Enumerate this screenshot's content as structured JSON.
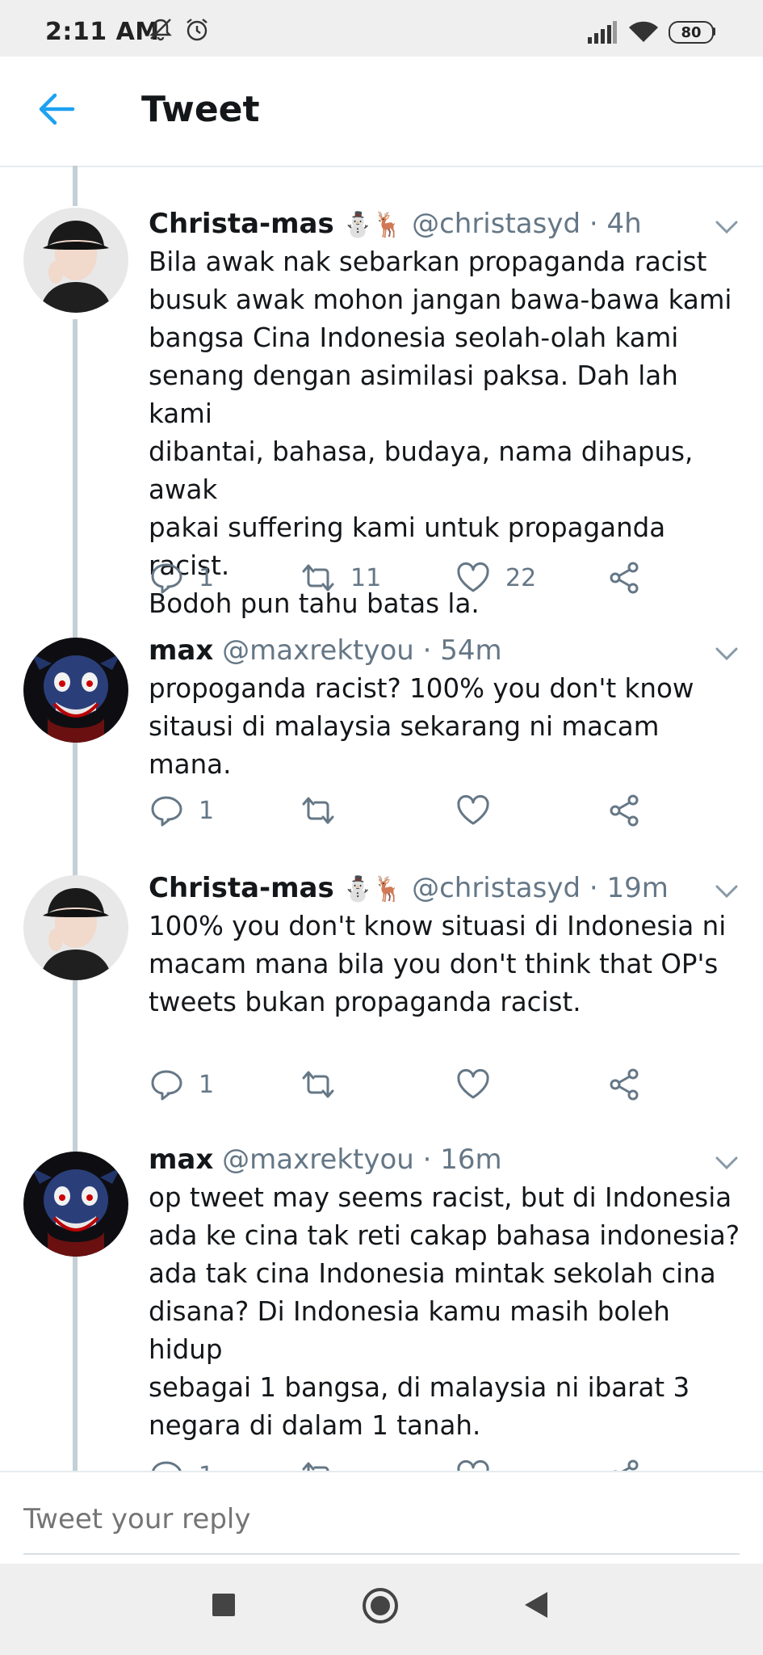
{
  "status_bar": {
    "time": "2:11 AM",
    "battery": "80",
    "icons": [
      "silent-mode-icon",
      "alarm-icon",
      "signal-icon",
      "wifi-icon",
      "battery-icon"
    ]
  },
  "header": {
    "title": "Tweet",
    "back_icon": "arrow-left-icon",
    "accent_color": "#1da1f2"
  },
  "tweets": [
    {
      "name": "Christa-mas",
      "emoji": "⛄🦌",
      "handle": "@christasyd",
      "sep": "·",
      "time": "4h",
      "text": "Bila awak nak sebarkan propaganda racist\nbusuk awak mohon jangan bawa-bawa kami\nbangsa Cina Indonesia seolah-olah kami\nsenang dengan asimilasi paksa. Dah lah kami\ndibantai, bahasa, budaya, nama dihapus, awak\npakai suffering kami untuk propaganda racist.\nBodoh pun tahu batas la.",
      "replies": "1",
      "retweets": "11",
      "likes": "22"
    },
    {
      "name": "max",
      "emoji": "",
      "handle": "@maxrektyou",
      "sep": "·",
      "time": "54m",
      "text": "propoganda racist? 100% you don't know\nsitausi di malaysia sekarang ni macam mana.",
      "replies": "1",
      "retweets": "",
      "likes": ""
    },
    {
      "name": "Christa-mas",
      "emoji": "⛄🦌",
      "handle": "@christasyd",
      "sep": "·",
      "time": "19m",
      "text": "100% you don't know situasi di Indonesia ni\nmacam mana bila you don't think that OP's\ntweets bukan propaganda racist.",
      "replies": "1",
      "retweets": "",
      "likes": ""
    },
    {
      "name": "max",
      "emoji": "",
      "handle": "@maxrektyou",
      "sep": "·",
      "time": "16m",
      "text": "op tweet may seems racist, but di Indonesia\nada ke cina tak reti cakap bahasa indonesia?\nada tak cina Indonesia mintak sekolah cina\ndisana? Di Indonesia kamu masih boleh hidup\nsebagai 1 bangsa, di malaysia ni ibarat 3\nnegara di dalam 1 tanah.",
      "replies": "1",
      "retweets": "",
      "likes": ""
    }
  ],
  "reply_bar": {
    "placeholder": "Tweet your reply"
  },
  "nav_bar": {
    "icons": [
      "recents-square-icon",
      "home-circle-icon",
      "back-triangle-icon"
    ]
  }
}
